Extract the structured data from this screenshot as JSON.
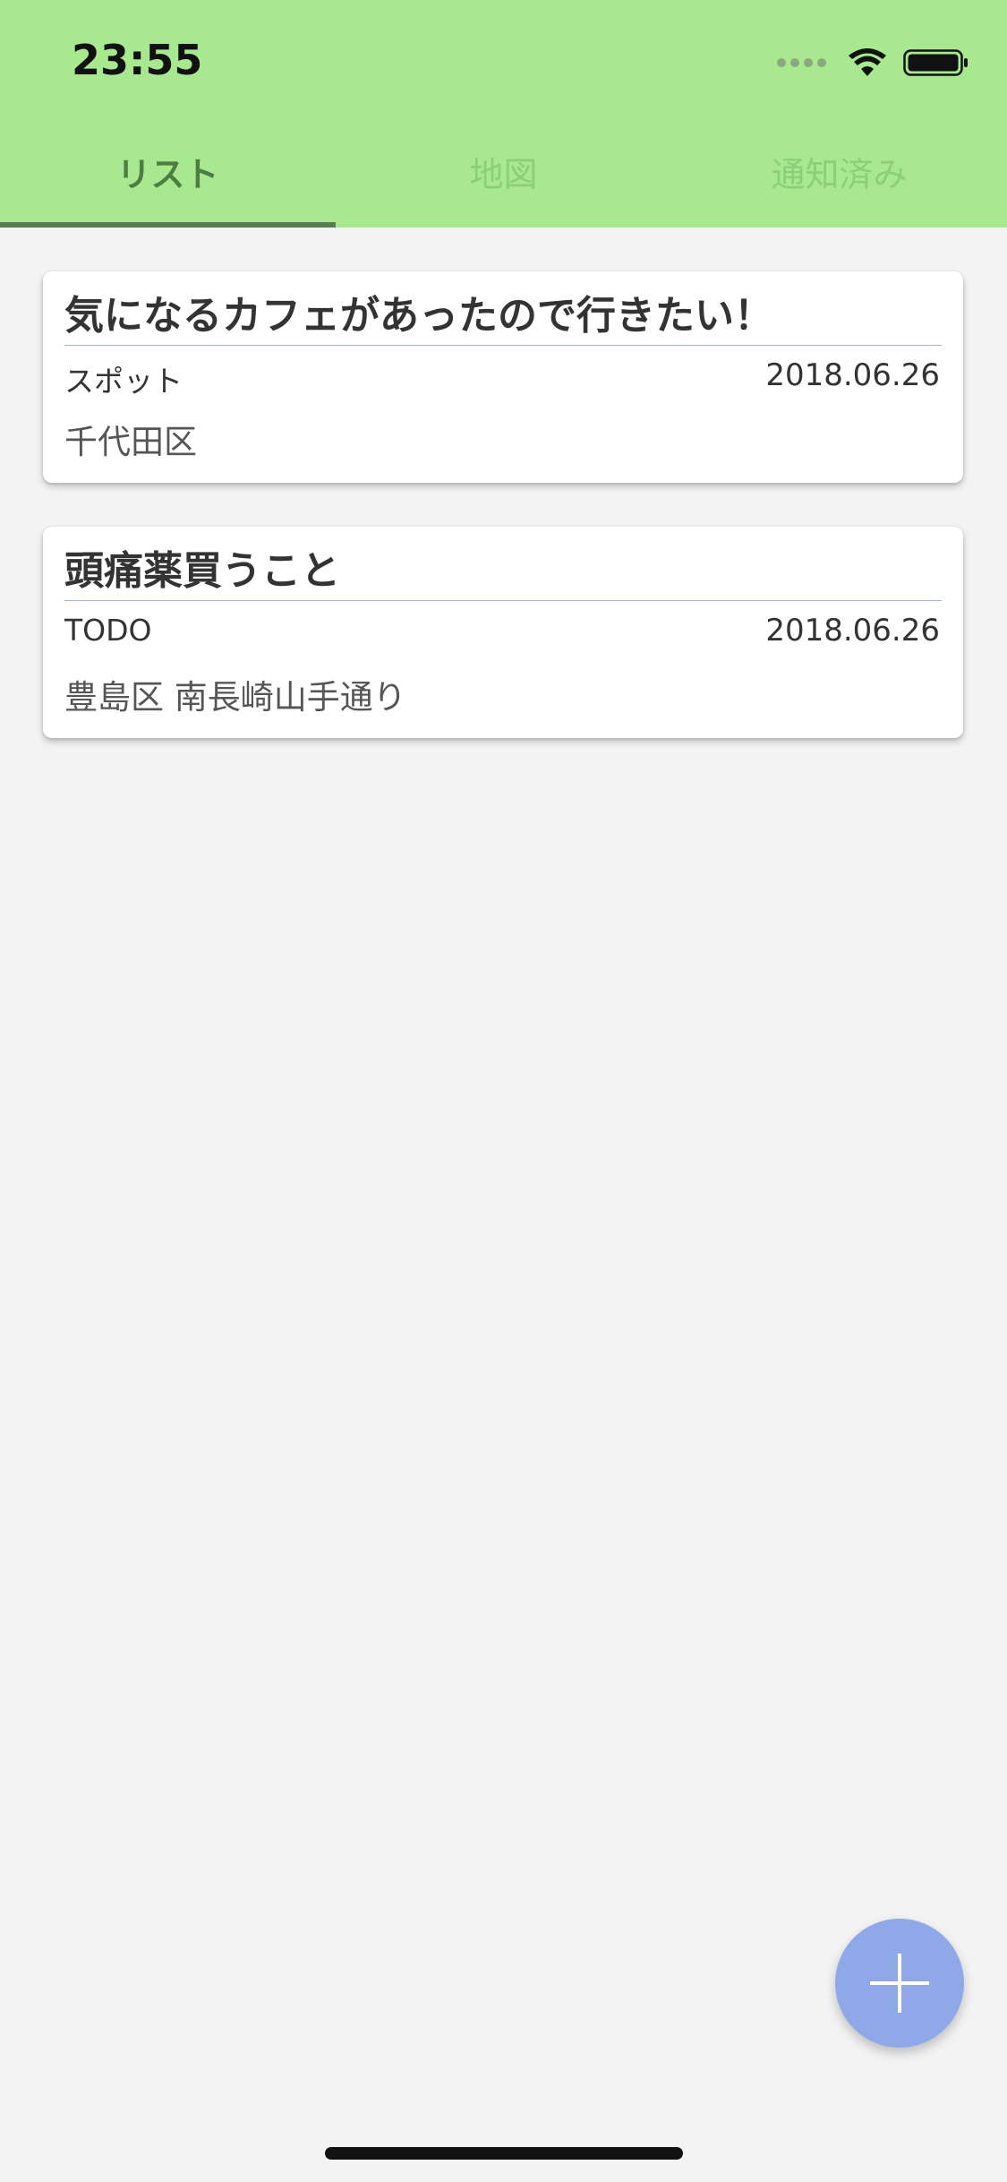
{
  "status_bar": {
    "time": "23:55"
  },
  "tabs": [
    {
      "label": "リスト",
      "active": true
    },
    {
      "label": "地図",
      "active": false
    },
    {
      "label": "通知済み",
      "active": false
    }
  ],
  "cards": [
    {
      "title": "気になるカフェがあったので行きたい！",
      "category": "スポット",
      "date": "2018.06.26",
      "location": "千代田区"
    },
    {
      "title": "頭痛薬買うこと",
      "category": "TODO",
      "date": "2018.06.26",
      "location": "豊島区 南長崎山手通り"
    }
  ],
  "fab": {
    "icon": "plus-icon"
  },
  "colors": {
    "header_bg": "#a8e88e",
    "tab_active": "#4d7d42",
    "tab_inactive": "#8ccf7a",
    "indicator": "#5a7d50",
    "fab_bg": "#8ea8e8",
    "title_underline": "#9fb3e8",
    "background": "#f3f3f3"
  }
}
